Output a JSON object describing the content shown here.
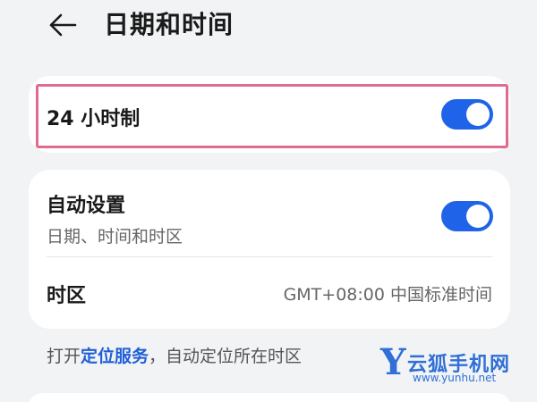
{
  "header": {
    "back_icon": "arrow-left-icon",
    "title": "日期和时间"
  },
  "time_format": {
    "label": "24 小时制",
    "toggle_on": true
  },
  "auto_settings": {
    "label": "自动设置",
    "sublabel": "日期、时间和时区",
    "toggle_on": true
  },
  "timezone": {
    "label": "时区",
    "value": "GMT+08:00 中国标准时间"
  },
  "footnote": {
    "prefix": "打开",
    "link": "定位服务",
    "suffix": "，自动定位所在时区"
  },
  "watermark": {
    "letter": "Y",
    "name": "云狐手机网",
    "url": "www.yunhu.net"
  },
  "colors": {
    "accent": "#1f63e8",
    "highlight": "#e06b8f",
    "background": "#f1f3f5"
  }
}
